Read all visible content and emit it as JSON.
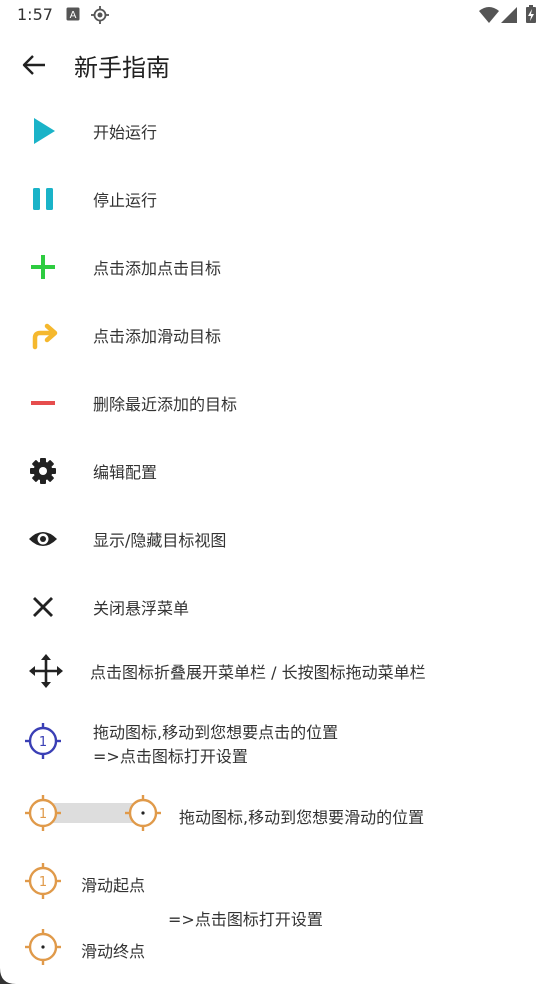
{
  "status_bar": {
    "time": "1:57",
    "icons": [
      "keyboard-a-icon",
      "gps-icon",
      "wifi-icon",
      "signal-icon",
      "battery-charging-icon"
    ]
  },
  "header": {
    "title": "新手指南",
    "back_icon": "arrow-back-icon"
  },
  "items": [
    {
      "label": "开始运行",
      "icon": "play-icon",
      "color": "#1ab3c8"
    },
    {
      "label": "停止运行",
      "icon": "pause-icon",
      "color": "#1ab3c8"
    },
    {
      "label": "点击添加点击目标",
      "icon": "plus-icon",
      "color": "#2ecc40"
    },
    {
      "label": "点击添加滑动目标",
      "icon": "swipe-arrow-icon",
      "color": "#f5b82e"
    },
    {
      "label": "删除最近添加的目标",
      "icon": "minus-icon",
      "color": "#e64d4d"
    },
    {
      "label": "编辑配置",
      "icon": "gear-icon",
      "color": "#222222"
    },
    {
      "label": "显示/隐藏目标视图",
      "icon": "eye-icon",
      "color": "#222222"
    },
    {
      "label": "关闭悬浮菜单",
      "icon": "close-icon",
      "color": "#222222"
    },
    {
      "label": "点击图标折叠展开菜单栏 / 长按图标拖动菜单栏",
      "icon": "move-icon",
      "color": "#222222"
    }
  ],
  "click_target": {
    "number": "1",
    "line1": "拖动图标,移动到您想要点击的位置",
    "line2": "=>点击图标打开设置",
    "color": "#3a3fb5"
  },
  "swipe_target": {
    "number": "1",
    "text": "拖动图标,移动到您想要滑动的位置",
    "color": "#e09a4a",
    "track_color": "#dddddd"
  },
  "swipe_legend": {
    "start_number": "1",
    "start_label": "滑动起点",
    "end_label": "滑动终点",
    "note": "=>点击图标打开设置",
    "color": "#e09a4a"
  }
}
